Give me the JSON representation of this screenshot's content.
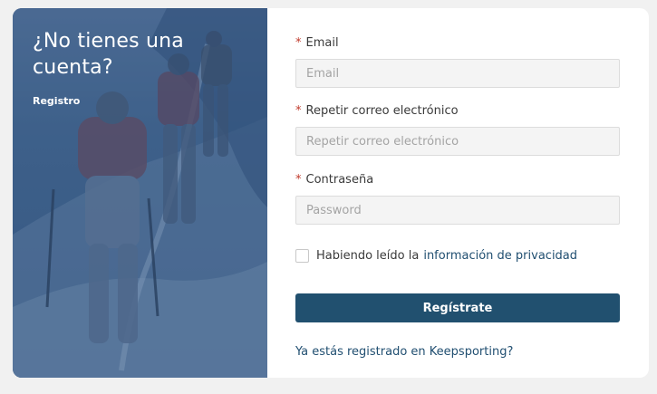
{
  "hero": {
    "title": "¿No tienes una cuenta?",
    "link": "Registro"
  },
  "form": {
    "email": {
      "label": "Email",
      "placeholder": "Email",
      "required_mark": "*"
    },
    "repeat_email": {
      "label": "Repetir correo electrónico",
      "placeholder": "Repetir correo electrónico",
      "required_mark": "*"
    },
    "password": {
      "label": "Contraseña",
      "placeholder": "Password",
      "required_mark": "*"
    },
    "privacy": {
      "text": "Habiendo leído la",
      "link": "información de privacidad",
      "checked": false
    },
    "submit_label": "Regístrate",
    "login_link": "Ya estás registrado en Keepsporting?"
  },
  "colors": {
    "primary": "#21506f",
    "hero_overlay": "#3d5e86",
    "required": "#c0392b",
    "input_bg": "#f4f4f4",
    "page_bg": "#f1f1f1"
  }
}
